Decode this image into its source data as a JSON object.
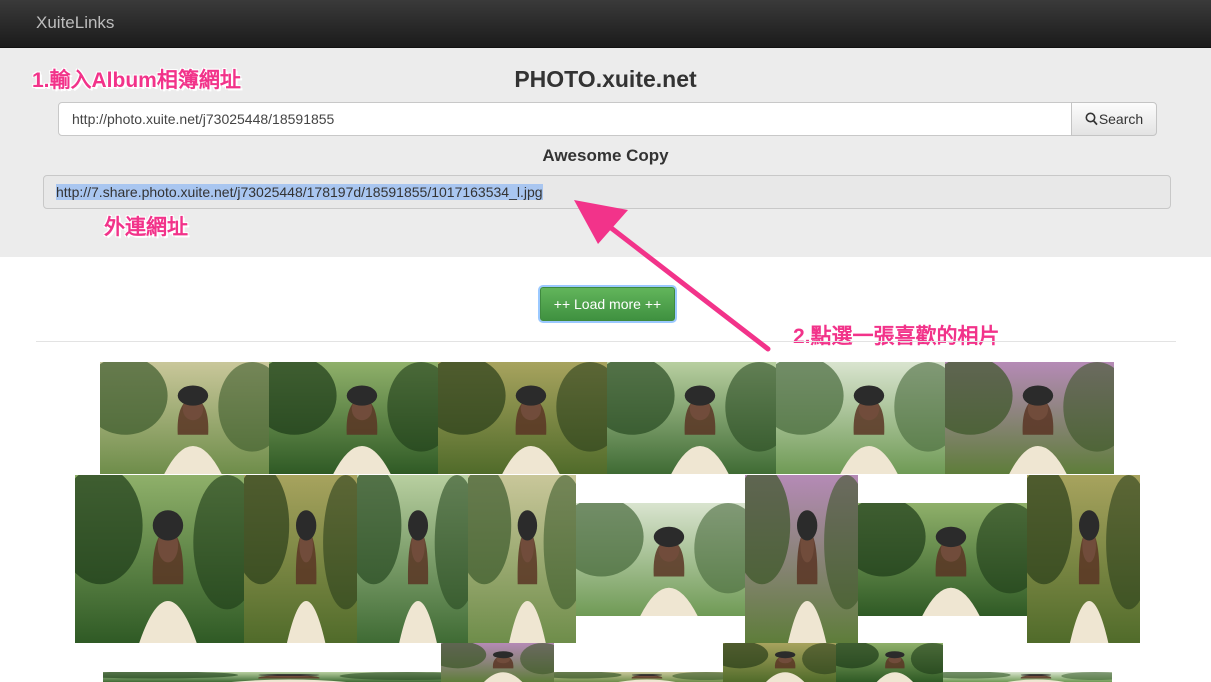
{
  "app": {
    "brand": "XuiteLinks"
  },
  "hero": {
    "site_title": "PHOTO.xuite.net",
    "search_value": "http://photo.xuite.net/j73025448/18591855",
    "search_label": "Search",
    "copy_heading": "Awesome Copy",
    "copy_value": "http://7.share.photo.xuite.net/j73025448/178197d/18591855/1017163534_l.jpg"
  },
  "annotations": {
    "step1": "1.輸入Album相簿網址",
    "link_label": "外連網址",
    "step2": "2.點選一張喜歡的相片"
  },
  "load_more": {
    "label": "++ Load more ++"
  },
  "colors": {
    "accent_annotation": "#f2338a",
    "load_more_green": "#4ea24c",
    "navbar": "#222222"
  },
  "gallery": {
    "row1": [
      "photo-1",
      "photo-2",
      "photo-3",
      "photo-4",
      "photo-5",
      "photo-6"
    ],
    "row2": [
      "photo-7",
      "photo-8",
      "photo-9",
      "photo-10",
      "photo-11",
      "photo-12",
      "photo-13",
      "photo-14"
    ]
  }
}
